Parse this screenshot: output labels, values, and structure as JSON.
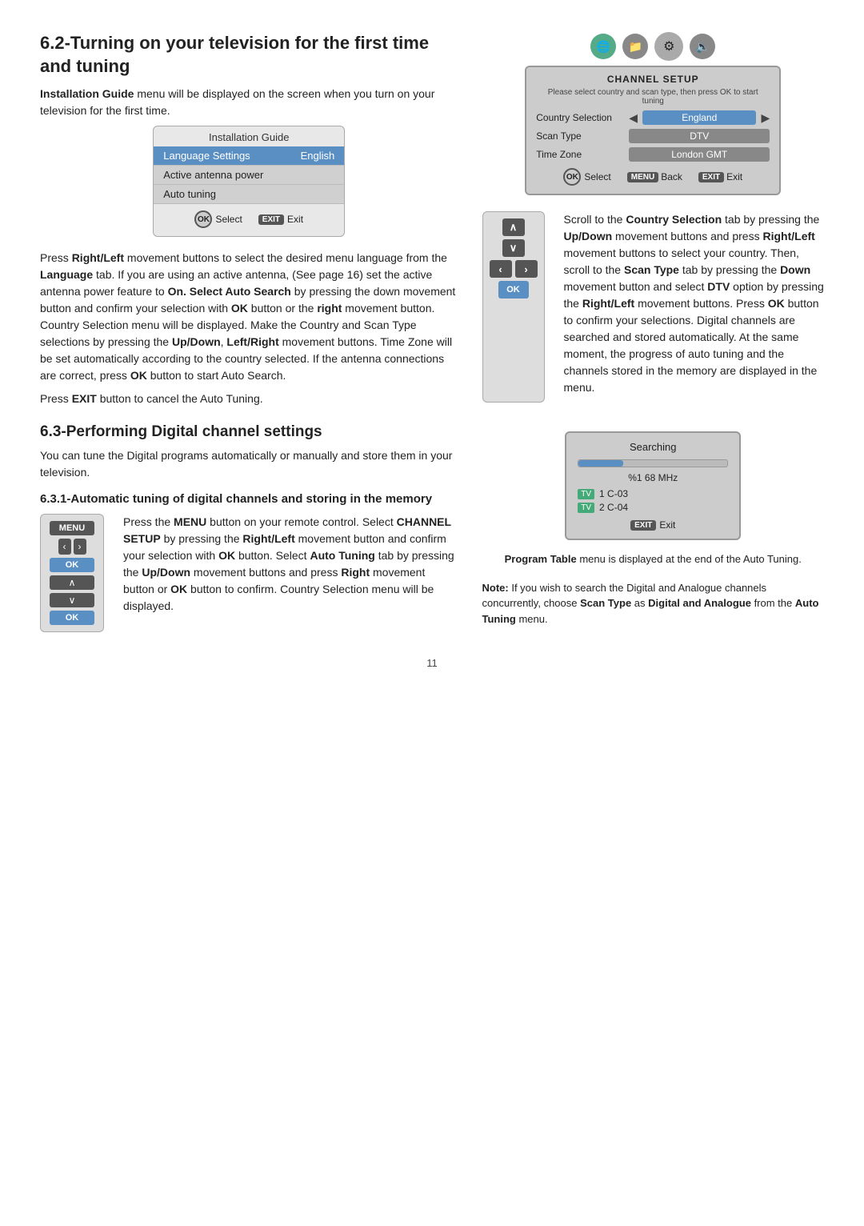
{
  "section62": {
    "title": "6.2-Turning on your television for the first time and tuning",
    "intro": {
      "bold": "Installation Guide",
      "rest": " menu will be displayed on the screen when you turn on your television for the first time."
    },
    "install_guide_ui": {
      "title": "Installation Guide",
      "rows": [
        {
          "label": "Language Settings",
          "value": "English",
          "active": true
        },
        {
          "label": "Active antenna power",
          "value": ""
        },
        {
          "label": "Auto tuning",
          "value": ""
        }
      ],
      "footer": {
        "select": "Select",
        "exit": "Exit"
      }
    },
    "body_text": [
      "Press ",
      "Right/Left",
      " movement buttons to select the desired menu language from the ",
      "Language",
      " tab. If you are using an active antenna, (See page 16) set the active antenna power feature to ",
      "On. Select Auto Search",
      " by pressing the down movement button and confirm your selection with ",
      "OK",
      " button or the ",
      "right",
      " movement button. Country Selection menu will be displayed. Make the Country and Scan Type selections by pressing the ",
      "Up/Down",
      ", ",
      "Left/Right",
      " movement buttons. Time Zone will be set automatically according to the country selected. If the antenna connections are correct, press ",
      "OK",
      " button to start Auto Search."
    ],
    "exit_note": "Press EXIT button to cancel the Auto Tuning."
  },
  "channel_setup_ui": {
    "title": "CHANNEL SETUP",
    "subtitle": "Please select country and scan type, then press OK to start tuning",
    "rows": [
      {
        "label": "Country Selection",
        "value": "England",
        "highlight": true
      },
      {
        "label": "Scan Type",
        "value": "DTV",
        "highlight": false
      },
      {
        "label": "Time Zone",
        "value": "London GMT",
        "highlight": false
      }
    ],
    "footer": {
      "select": "Select",
      "back": "Back",
      "exit": "Exit"
    }
  },
  "directions_text": "Scroll to the Country Selection tab by pressing the Up/Down movement buttons and press Right/Left movement buttons to select your country. Then, scroll to the Scan Type tab by pressing the Down movement button and select DTV option by pressing the Right/Left movement buttons. Press OK button to confirm your selections. Digital channels are searched and stored automatically. At the same moment, the progress of auto tuning and the channels stored in the memory are displayed in the menu.",
  "section63": {
    "title": "6.3-Performing Digital channel settings",
    "intro": "You can tune the Digital programs automatically or manually and store them in your television.",
    "subsection": {
      "title": "6.3.1-Automatic tuning of digital channels and storing in the memory",
      "body": "Press the MENU button on your remote control. Select CHANNEL SETUP by pressing the Right/Left movement button and confirm your selection with OK button. Select Auto Tuning tab by pressing the Up/Down movement buttons and press Right movement button or OK button to confirm. Country Selection menu will be displayed."
    }
  },
  "searching_ui": {
    "title": "Searching",
    "frequency": "%1 68 MHz",
    "channels": [
      {
        "label": "TV",
        "name": "1 C-03"
      },
      {
        "label": "TV",
        "name": "2 C-04"
      }
    ],
    "footer": "Exit"
  },
  "program_table_text": "Program Table menu is displayed at the end of the Auto Tuning.",
  "note_text": "Note: If you wish to search the Digital and Analogue channels concurrently, choose Scan Type as Digital and Analogue from the Auto Tuning menu.",
  "page_number": "11"
}
